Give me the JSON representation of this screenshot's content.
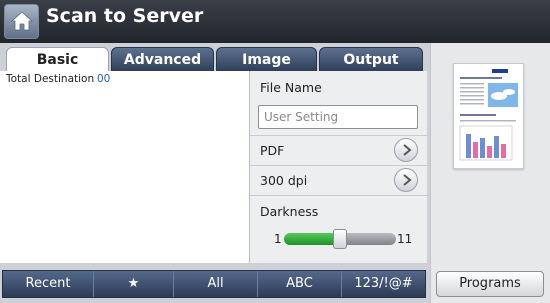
{
  "header": {
    "title": "Scan to Server"
  },
  "tabs": [
    {
      "label": "Basic",
      "active": true
    },
    {
      "label": "Advanced",
      "active": false
    },
    {
      "label": "Image",
      "active": false
    },
    {
      "label": "Output",
      "active": false
    }
  ],
  "destination": {
    "label": "Total Destination",
    "count": "00"
  },
  "settings": {
    "file_name_label": "File Name",
    "file_name_placeholder": "User Setting",
    "format": "PDF",
    "resolution": "300 dpi",
    "darkness_label": "Darkness",
    "darkness_min": "1",
    "darkness_max": "11",
    "darkness_level_fraction": 0.5
  },
  "bottom_bar": [
    "Recent",
    "★",
    "All",
    "ABC",
    "123/!@#"
  ],
  "programs_label": "Programs",
  "colors": {
    "slider_fill": "#2ea936",
    "tab_active": "#ffffff",
    "tab_inactive": "#3d4f6c"
  }
}
